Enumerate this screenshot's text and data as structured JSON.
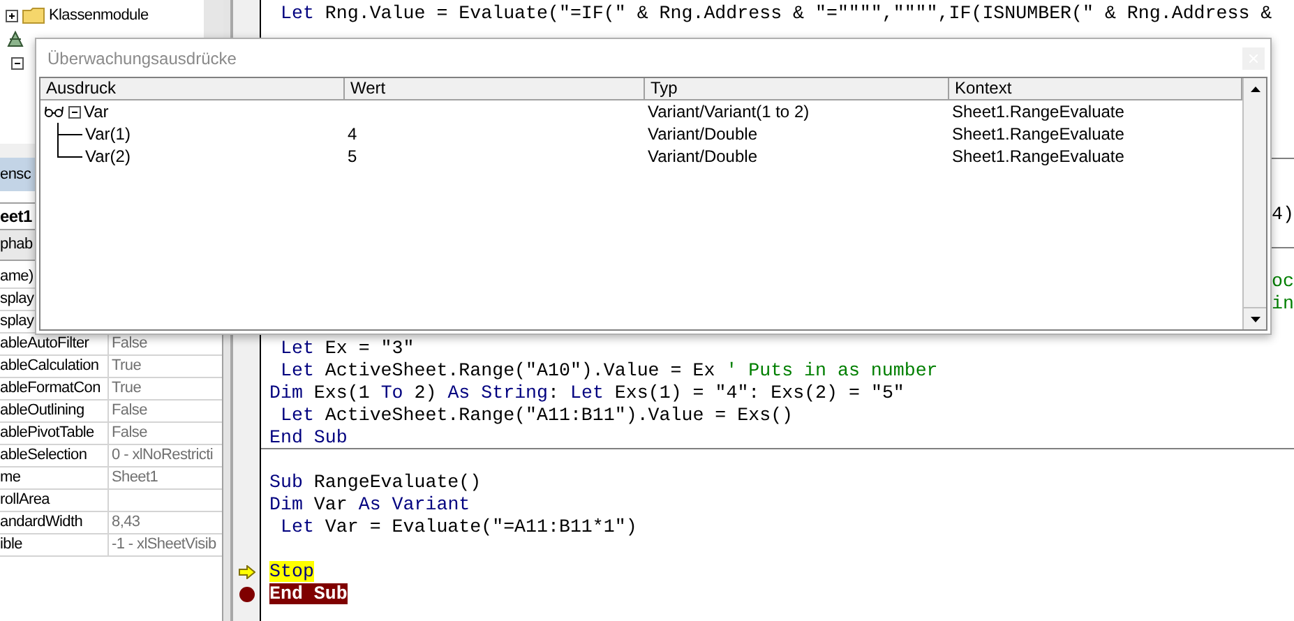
{
  "project_tree": {
    "items": [
      {
        "kind": "folder",
        "label": "Klassenmodule",
        "expanded": false
      },
      {
        "kind": "project"
      },
      {
        "kind": "node",
        "expanded": true
      }
    ]
  },
  "properties": {
    "title": "ensc",
    "object": "eet1",
    "tab": "phab",
    "rows": [
      {
        "name": "ame)"
      },
      {
        "name": "splay"
      },
      {
        "name": "splay"
      },
      {
        "name": "ableAutoFilter",
        "value": "False"
      },
      {
        "name": "ableCalculation",
        "value": "True"
      },
      {
        "name": "ableFormatCon",
        "value": "True"
      },
      {
        "name": "ableOutlining",
        "value": "False"
      },
      {
        "name": "ablePivotTable",
        "value": "False"
      },
      {
        "name": "ableSelection",
        "value": "0 - xlNoRestricti"
      },
      {
        "name": "me",
        "value": "Sheet1"
      },
      {
        "name": "rollArea"
      },
      {
        "name": "andardWidth",
        "value": "8,43"
      },
      {
        "name": "ible",
        "value": "-1 - xlSheetVisib"
      }
    ]
  },
  "code_window": {
    "lines": [
      {
        "kind": "code",
        "segments": [
          {
            "t": " Let",
            "kind": "keyword"
          },
          {
            "t": " Rng.Value = Evaluate(\"=IF(\" & Rng.Address & \"=\"\"\"\",\"\"\"\",IF(ISNUMBER(\" & Rng.Address &",
            "kind": "plain"
          }
        ]
      },
      {
        "kind": "blank"
      },
      {
        "kind": "blank"
      },
      {
        "kind": "blank"
      },
      {
        "kind": "blank"
      },
      {
        "kind": "blank"
      },
      {
        "kind": "blank",
        "separator": true
      },
      {
        "kind": "blank"
      },
      {
        "kind": "blank"
      },
      {
        "kind": "fragment",
        "segments": [
          {
            "t": "4)",
            "kind": "plain"
          }
        ]
      },
      {
        "kind": "blank",
        "separator": true
      },
      {
        "kind": "blank"
      },
      {
        "kind": "fragment",
        "segments": [
          {
            "t": "oc",
            "kind": "comment"
          }
        ]
      },
      {
        "kind": "fragment",
        "segments": [
          {
            "t": "in",
            "kind": "comment"
          }
        ]
      },
      {
        "kind": "blank"
      },
      {
        "kind": "code",
        "segments": [
          {
            "t": " Let",
            "kind": "keyword"
          },
          {
            "t": " Ex = \"3\"",
            "kind": "plain"
          }
        ]
      },
      {
        "kind": "code",
        "segments": [
          {
            "t": " Let",
            "kind": "keyword"
          },
          {
            "t": " ActiveSheet.Range(\"A10\").Value = Ex ",
            "kind": "plain"
          },
          {
            "t": "' Puts in as number",
            "kind": "comment"
          }
        ]
      },
      {
        "kind": "code",
        "segments": [
          {
            "t": "Dim",
            "kind": "keyword"
          },
          {
            "t": " Exs(1 ",
            "kind": "plain"
          },
          {
            "t": "To",
            "kind": "keyword"
          },
          {
            "t": " 2) ",
            "kind": "plain"
          },
          {
            "t": "As String",
            "kind": "keyword"
          },
          {
            "t": ": ",
            "kind": "plain"
          },
          {
            "t": "Let",
            "kind": "keyword"
          },
          {
            "t": " Exs(1) = \"4\": Exs(2) = \"5\"",
            "kind": "plain"
          }
        ]
      },
      {
        "kind": "code",
        "segments": [
          {
            "t": " Let",
            "kind": "keyword"
          },
          {
            "t": " ActiveSheet.Range(\"A11:B11\").Value = Exs()",
            "kind": "plain"
          }
        ]
      },
      {
        "kind": "code",
        "separator": true,
        "segments": [
          {
            "t": "End Sub",
            "kind": "keyword"
          }
        ]
      },
      {
        "kind": "blank"
      },
      {
        "kind": "code",
        "segments": [
          {
            "t": "Sub",
            "kind": "keyword"
          },
          {
            "t": " RangeEvaluate()",
            "kind": "plain"
          }
        ]
      },
      {
        "kind": "code",
        "segments": [
          {
            "t": "Dim",
            "kind": "keyword"
          },
          {
            "t": " Var ",
            "kind": "plain"
          },
          {
            "t": "As Variant",
            "kind": "keyword"
          }
        ]
      },
      {
        "kind": "code",
        "segments": [
          {
            "t": " Let",
            "kind": "keyword"
          },
          {
            "t": " Var = Evaluate(\"=A11:B11*1\")",
            "kind": "plain"
          }
        ]
      },
      {
        "kind": "blank"
      },
      {
        "kind": "code",
        "current": true,
        "segments": [
          {
            "t": "Stop",
            "kind": "keyword"
          }
        ]
      },
      {
        "kind": "code",
        "breakpoint": true,
        "segments": [
          {
            "t": "End Sub"
          }
        ]
      }
    ]
  },
  "watch_window": {
    "title": "Überwachungsausdrücke",
    "columns": [
      "Ausdruck",
      "Wert",
      "Typ",
      "Kontext"
    ],
    "rows": [
      {
        "expression": "Var",
        "type": "Variant/Variant(1 to 2)",
        "context": "Sheet1.RangeEvaluate",
        "expanded": true,
        "children": [
          {
            "expression": "Var(1)",
            "value": "4",
            "type": "Variant/Double",
            "context": "Sheet1.RangeEvaluate"
          },
          {
            "expression": "Var(2)",
            "value": "5",
            "type": "Variant/Double",
            "context": "Sheet1.RangeEvaluate"
          }
        ]
      }
    ]
  }
}
